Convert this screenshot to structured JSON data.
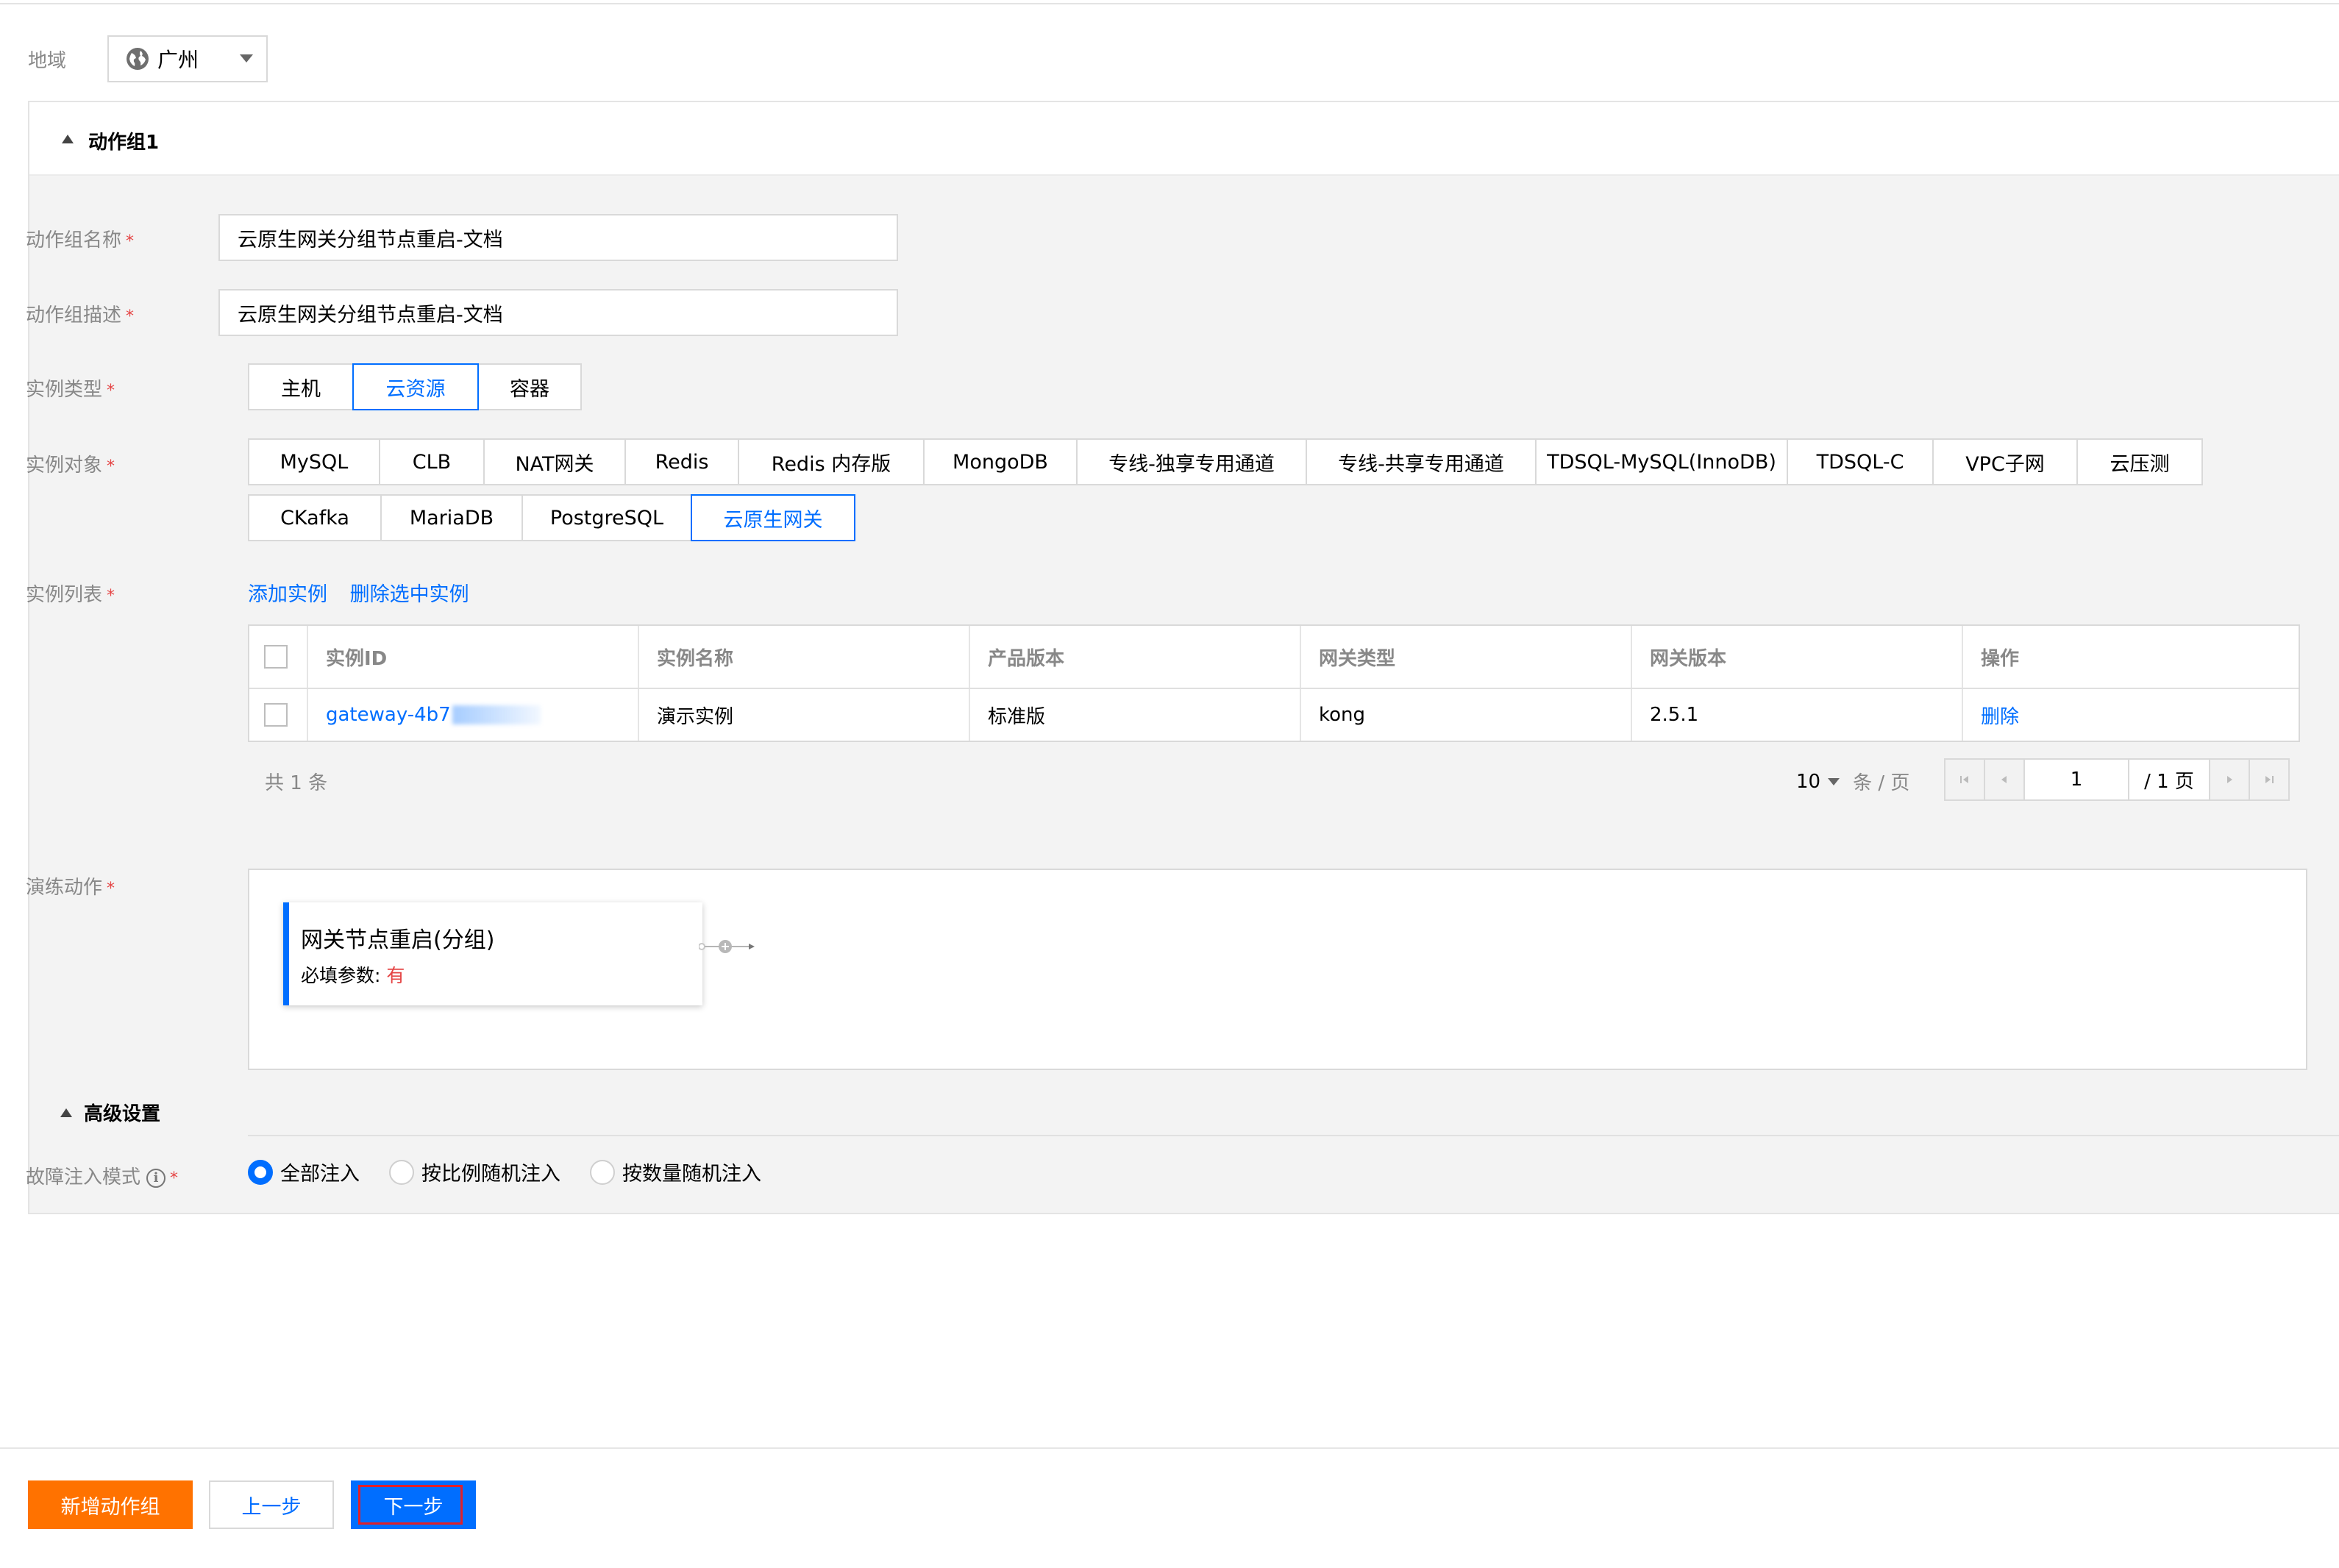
{
  "region": {
    "label": "地域",
    "value": "广州"
  },
  "group": {
    "title": "动作组1",
    "name_label": "动作组名称",
    "name_value": "云原生网关分组节点重启-文档",
    "desc_label": "动作组描述",
    "desc_value": "云原生网关分组节点重启-文档",
    "instance_type_label": "实例类型",
    "instance_types": [
      "主机",
      "云资源",
      "容器"
    ],
    "instance_type_selected": "云资源",
    "instance_object_label": "实例对象",
    "instance_objects_row1": [
      "MySQL",
      "CLB",
      "NAT网关",
      "Redis",
      "Redis 内存版",
      "MongoDB",
      "专线-独享专用通道",
      "专线-共享专用通道",
      "TDSQL-MySQL(InnoDB)",
      "TDSQL-C",
      "VPC子网",
      "云压测"
    ],
    "instance_objects_row2": [
      "CKafka",
      "MariaDB",
      "PostgreSQL",
      "云原生网关"
    ],
    "instance_object_selected": "云原生网关",
    "instance_list_label": "实例列表",
    "add_instance": "添加实例",
    "delete_selected": "删除选中实例"
  },
  "table": {
    "columns": [
      "实例ID",
      "实例名称",
      "产品版本",
      "网关类型",
      "网关版本",
      "操作"
    ],
    "rows": [
      {
        "id": "gateway-4b7",
        "name": "演示实例",
        "version": "标准版",
        "gw_type": "kong",
        "gw_version": "2.5.1",
        "action": "删除"
      }
    ]
  },
  "pagination": {
    "total_text": "共 1 条",
    "page_size": "10",
    "page_size_unit": "条 / 页",
    "current_page": "1",
    "total_pages_text": "/ 1 页"
  },
  "drill": {
    "label": "演练动作",
    "action_title": "网关节点重启(分组)",
    "param_label": "必填参数:",
    "param_value": "有"
  },
  "advanced": {
    "title": "高级设置",
    "mode_label": "故障注入模式",
    "modes": [
      "全部注入",
      "按比例随机注入",
      "按数量随机注入"
    ],
    "mode_selected": "全部注入"
  },
  "footer": {
    "add_group": "新增动作组",
    "prev": "上一步",
    "next": "下一步"
  },
  "colors": {
    "primary": "#006eff",
    "orange": "#ff7200",
    "required": "#e54545"
  }
}
